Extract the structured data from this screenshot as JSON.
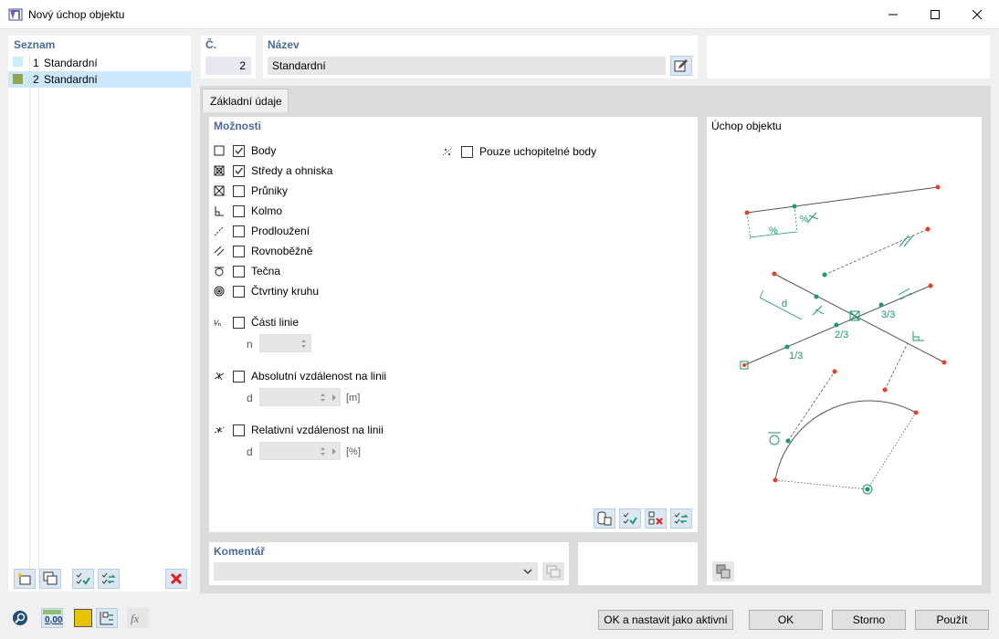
{
  "window": {
    "title": "Nový úchop objektu"
  },
  "list": {
    "header": "Seznam",
    "items": [
      {
        "num": "1",
        "label": "Standardní",
        "color": "#c8f0f5"
      },
      {
        "num": "2",
        "label": "Standardní",
        "color": "#8fa54f"
      }
    ]
  },
  "fields": {
    "number_label": "Č.",
    "number_value": "2",
    "name_label": "Název",
    "name_value": "Standardní"
  },
  "tab": {
    "label": "Základní údaje"
  },
  "options": {
    "header": "Možnosti",
    "items": [
      {
        "label": "Body",
        "checked": true
      },
      {
        "label": "Středy a ohniska",
        "checked": true
      },
      {
        "label": "Průniky",
        "checked": false
      },
      {
        "label": "Kolmo",
        "checked": false
      },
      {
        "label": "Prodloužení",
        "checked": false
      },
      {
        "label": "Rovnoběžně",
        "checked": false
      },
      {
        "label": "Tečna",
        "checked": false
      },
      {
        "label": "Čtvrtiny kruhu",
        "checked": false
      }
    ],
    "line_parts": {
      "label": "Části linie",
      "param": "n"
    },
    "abs_dist": {
      "label": "Absolutní vzdálenost na linii",
      "param": "d",
      "unit": "[m]"
    },
    "rel_dist": {
      "label": "Relativní vzdálenost na linii",
      "param": "d",
      "unit": "[%]"
    },
    "grip_only": {
      "label": "Pouze uchopitelné body",
      "checked": false
    }
  },
  "comment": {
    "header": "Komentář"
  },
  "preview": {
    "header": "Úchop objektu",
    "labels": {
      "percent": "%",
      "d": "d",
      "third1": "1/3",
      "third2": "2/3",
      "third3": "3/3"
    }
  },
  "buttons": {
    "ok_active": "OK a nastavit jako aktivní",
    "ok": "OK",
    "cancel": "Storno",
    "apply": "Použít"
  },
  "footer": {
    "units_label": "0,00"
  },
  "colors": {
    "accent": "#4b6a9b",
    "selected": "#cce8ff",
    "green": "#1a9a6a",
    "red": "#e8401c"
  }
}
